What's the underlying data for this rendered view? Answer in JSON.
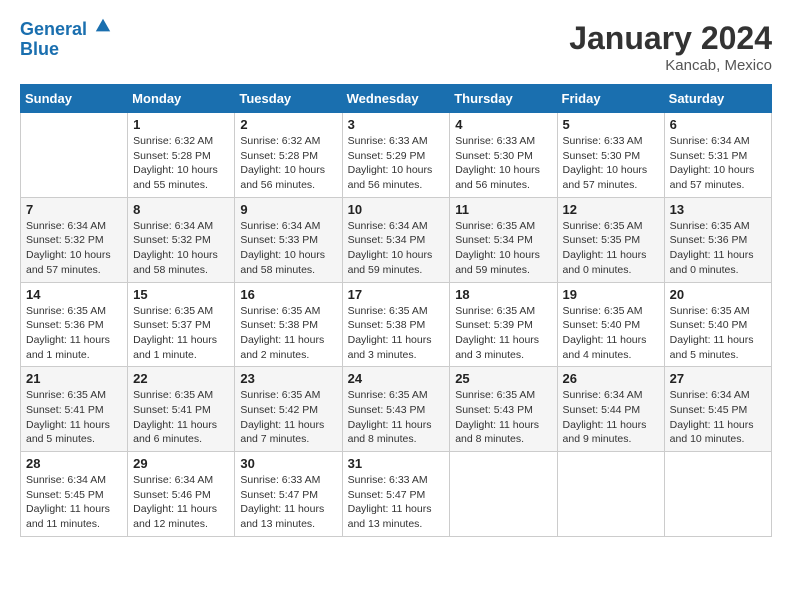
{
  "header": {
    "logo_line1": "General",
    "logo_line2": "Blue",
    "month_title": "January 2024",
    "location": "Kancab, Mexico"
  },
  "weekdays": [
    "Sunday",
    "Monday",
    "Tuesday",
    "Wednesday",
    "Thursday",
    "Friday",
    "Saturday"
  ],
  "weeks": [
    [
      {
        "day": "",
        "info": ""
      },
      {
        "day": "1",
        "info": "Sunrise: 6:32 AM\nSunset: 5:28 PM\nDaylight: 10 hours\nand 55 minutes."
      },
      {
        "day": "2",
        "info": "Sunrise: 6:32 AM\nSunset: 5:28 PM\nDaylight: 10 hours\nand 56 minutes."
      },
      {
        "day": "3",
        "info": "Sunrise: 6:33 AM\nSunset: 5:29 PM\nDaylight: 10 hours\nand 56 minutes."
      },
      {
        "day": "4",
        "info": "Sunrise: 6:33 AM\nSunset: 5:30 PM\nDaylight: 10 hours\nand 56 minutes."
      },
      {
        "day": "5",
        "info": "Sunrise: 6:33 AM\nSunset: 5:30 PM\nDaylight: 10 hours\nand 57 minutes."
      },
      {
        "day": "6",
        "info": "Sunrise: 6:34 AM\nSunset: 5:31 PM\nDaylight: 10 hours\nand 57 minutes."
      }
    ],
    [
      {
        "day": "7",
        "info": "Sunrise: 6:34 AM\nSunset: 5:32 PM\nDaylight: 10 hours\nand 57 minutes."
      },
      {
        "day": "8",
        "info": "Sunrise: 6:34 AM\nSunset: 5:32 PM\nDaylight: 10 hours\nand 58 minutes."
      },
      {
        "day": "9",
        "info": "Sunrise: 6:34 AM\nSunset: 5:33 PM\nDaylight: 10 hours\nand 58 minutes."
      },
      {
        "day": "10",
        "info": "Sunrise: 6:34 AM\nSunset: 5:34 PM\nDaylight: 10 hours\nand 59 minutes."
      },
      {
        "day": "11",
        "info": "Sunrise: 6:35 AM\nSunset: 5:34 PM\nDaylight: 10 hours\nand 59 minutes."
      },
      {
        "day": "12",
        "info": "Sunrise: 6:35 AM\nSunset: 5:35 PM\nDaylight: 11 hours\nand 0 minutes."
      },
      {
        "day": "13",
        "info": "Sunrise: 6:35 AM\nSunset: 5:36 PM\nDaylight: 11 hours\nand 0 minutes."
      }
    ],
    [
      {
        "day": "14",
        "info": "Sunrise: 6:35 AM\nSunset: 5:36 PM\nDaylight: 11 hours\nand 1 minute."
      },
      {
        "day": "15",
        "info": "Sunrise: 6:35 AM\nSunset: 5:37 PM\nDaylight: 11 hours\nand 1 minute."
      },
      {
        "day": "16",
        "info": "Sunrise: 6:35 AM\nSunset: 5:38 PM\nDaylight: 11 hours\nand 2 minutes."
      },
      {
        "day": "17",
        "info": "Sunrise: 6:35 AM\nSunset: 5:38 PM\nDaylight: 11 hours\nand 3 minutes."
      },
      {
        "day": "18",
        "info": "Sunrise: 6:35 AM\nSunset: 5:39 PM\nDaylight: 11 hours\nand 3 minutes."
      },
      {
        "day": "19",
        "info": "Sunrise: 6:35 AM\nSunset: 5:40 PM\nDaylight: 11 hours\nand 4 minutes."
      },
      {
        "day": "20",
        "info": "Sunrise: 6:35 AM\nSunset: 5:40 PM\nDaylight: 11 hours\nand 5 minutes."
      }
    ],
    [
      {
        "day": "21",
        "info": "Sunrise: 6:35 AM\nSunset: 5:41 PM\nDaylight: 11 hours\nand 5 minutes."
      },
      {
        "day": "22",
        "info": "Sunrise: 6:35 AM\nSunset: 5:41 PM\nDaylight: 11 hours\nand 6 minutes."
      },
      {
        "day": "23",
        "info": "Sunrise: 6:35 AM\nSunset: 5:42 PM\nDaylight: 11 hours\nand 7 minutes."
      },
      {
        "day": "24",
        "info": "Sunrise: 6:35 AM\nSunset: 5:43 PM\nDaylight: 11 hours\nand 8 minutes."
      },
      {
        "day": "25",
        "info": "Sunrise: 6:35 AM\nSunset: 5:43 PM\nDaylight: 11 hours\nand 8 minutes."
      },
      {
        "day": "26",
        "info": "Sunrise: 6:34 AM\nSunset: 5:44 PM\nDaylight: 11 hours\nand 9 minutes."
      },
      {
        "day": "27",
        "info": "Sunrise: 6:34 AM\nSunset: 5:45 PM\nDaylight: 11 hours\nand 10 minutes."
      }
    ],
    [
      {
        "day": "28",
        "info": "Sunrise: 6:34 AM\nSunset: 5:45 PM\nDaylight: 11 hours\nand 11 minutes."
      },
      {
        "day": "29",
        "info": "Sunrise: 6:34 AM\nSunset: 5:46 PM\nDaylight: 11 hours\nand 12 minutes."
      },
      {
        "day": "30",
        "info": "Sunrise: 6:33 AM\nSunset: 5:47 PM\nDaylight: 11 hours\nand 13 minutes."
      },
      {
        "day": "31",
        "info": "Sunrise: 6:33 AM\nSunset: 5:47 PM\nDaylight: 11 hours\nand 13 minutes."
      },
      {
        "day": "",
        "info": ""
      },
      {
        "day": "",
        "info": ""
      },
      {
        "day": "",
        "info": ""
      }
    ]
  ]
}
